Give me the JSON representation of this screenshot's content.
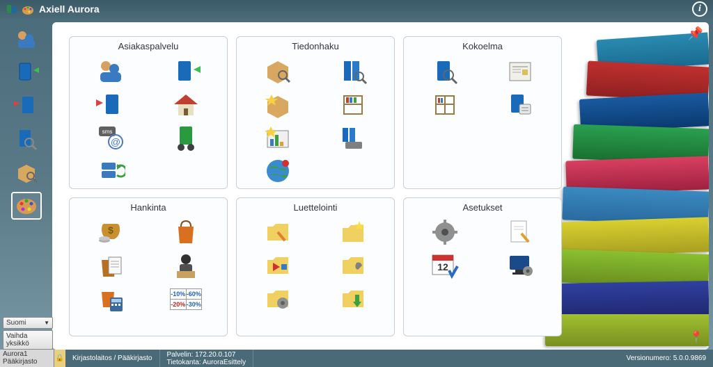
{
  "titlebar": {
    "title": "Axiell Aurora",
    "info_glyph": "i"
  },
  "modules": {
    "customer": {
      "title": "Asiakaspalvelu"
    },
    "search": {
      "title": "Tiedonhaku"
    },
    "collection": {
      "title": "Kokoelma"
    },
    "acquisition": {
      "title": "Hankinta"
    },
    "catalog": {
      "title": "Luettelointi"
    },
    "settings": {
      "title": "Asetukset"
    }
  },
  "discounts": {
    "a": "-10%",
    "b": "-60%",
    "c": "-20%",
    "d": "-30%"
  },
  "calendar_day": "12",
  "language": {
    "selected": "Suomi"
  },
  "unit_button": "Vaihda yksikkö",
  "statusbar": {
    "user_line1": "Aurora1",
    "user_line2": "Pääkirjasto",
    "library": "Kirjastolaitos / Pääkirjasto",
    "server_label": "Palvelin:",
    "server_value": "172.20.0.107",
    "db_label": "Tietokanta:",
    "db_value": "AuroraEsittely",
    "version_label": "Versionumero:",
    "version_value": "5.0.0.9869"
  }
}
